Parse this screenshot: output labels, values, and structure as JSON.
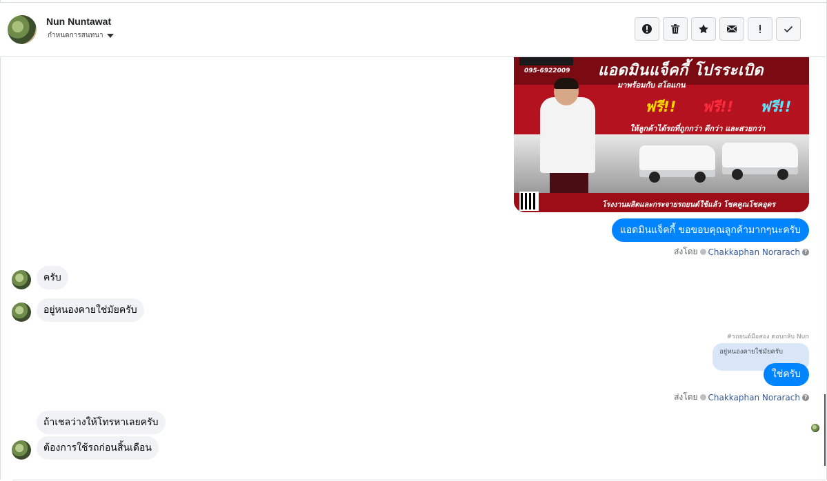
{
  "header": {
    "contact_name": "Nun Nuntawat",
    "status_label": "กำหนดการสนทนา",
    "actions": [
      {
        "name": "report",
        "icon": "alert-circle-icon"
      },
      {
        "name": "delete",
        "icon": "trash-icon"
      },
      {
        "name": "star",
        "icon": "star-icon"
      },
      {
        "name": "mark-unread",
        "icon": "envelope-icon"
      },
      {
        "name": "flag",
        "icon": "exclamation-icon"
      },
      {
        "name": "done",
        "icon": "check-icon"
      }
    ]
  },
  "promo_image": {
    "title": "แอดมินแจ็คกี้ โปรระเบิด",
    "phone": "095-6922009",
    "subtitle": "มาพร้อมกับ สโลแกน",
    "free_words": [
      "ฟรี!!",
      "ฟรี!!",
      "ฟรี!!"
    ],
    "free_colors": [
      "#ffd800",
      "#ff2a3b",
      "#5ee6ff"
    ],
    "tagline": "ให้ลูกค้าได้รถที่ถูกกว่า ดีกว่า และสวยกว่า",
    "footer": "โรงงานผลิตและกระจายรถยนต์ใช้แล้ว โชคคูณโชคอุดร"
  },
  "messages": {
    "out1": "แอดมินแจ็คกี้ ขอขอบคุณลูกค้ามากๆนะครับ",
    "sent_by_prefix": "ส่งโดย",
    "agent_name": "Chakkaphan Norarach",
    "in1": "ครับ",
    "in2": "อยู่หนองคายใช่มัยครับ",
    "reply_meta": "#รถยนต์มือสอง ตอบกลับ Nun",
    "quoted_text": "อยู่หนองคายใช่มัยครับ",
    "out2": "ใช่ครับ",
    "in3": "ถ้าเชลว่างให้โทรหาเลยครับ",
    "in4": "ต้องการใช้รถก่อนสิ้นเดือน"
  }
}
